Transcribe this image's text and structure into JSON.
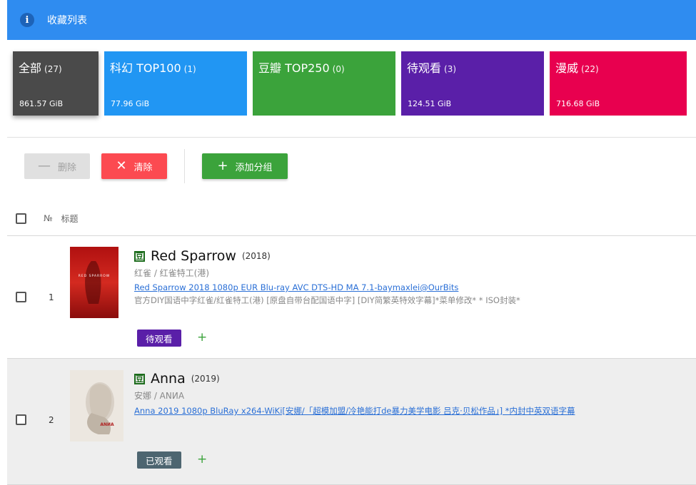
{
  "header": {
    "icon": "info-icon",
    "icon_glyph": "i",
    "title": "收藏列表"
  },
  "groups": [
    {
      "name": "全部",
      "count": "(27)",
      "size": "861.57 GiB",
      "color": "#4a4a4a",
      "active": true,
      "width": 120
    },
    {
      "name": "科幻 TOP100",
      "count": "(1)",
      "size": "77.96 GiB",
      "color": "#2196f3",
      "active": false,
      "width": 200
    },
    {
      "name": "豆瓣 TOP250",
      "count": "(0)",
      "size": "",
      "color": "#3ba33b",
      "active": false,
      "width": 200
    },
    {
      "name": "待观看",
      "count": "(3)",
      "size": "124.51 GiB",
      "color": "#5a1fa8",
      "active": false,
      "width": 200
    },
    {
      "name": "漫威",
      "count": "(22)",
      "size": "716.68 GiB",
      "color": "#e8004f",
      "active": false,
      "width": 200
    }
  ],
  "toolbar": {
    "delete_label": "删除",
    "delete_icon": "—",
    "clear_label": "清除",
    "clear_icon": "✕",
    "add_label": "添加分组",
    "add_icon": "+"
  },
  "table": {
    "col_no": "№",
    "col_title": "标题"
  },
  "rows": [
    {
      "no": "1",
      "title": "Red Sparrow",
      "year": "(2018)",
      "alt": "红雀 / 红雀特工(港)",
      "torrent": "Red Sparrow 2018 1080p EUR Blu-ray AVC DTS-HD MA 7.1-baymaxlei@OurBits",
      "subtitle": "官方DIY国语中字红雀/红雀特工(港) [原盘自带台配国语中字] [DIY简繁英特效字幕]*菜单修改* * ISO封装*",
      "tag": "待观看",
      "tag_color": "#5a1fa8",
      "poster_text": "RED SPARROW",
      "db_glyph": "豆"
    },
    {
      "no": "2",
      "title": "Anna",
      "year": "(2019)",
      "alt": "安娜 / ANИA",
      "torrent": "Anna 2019 1080p BluRay x264-WiKi[安娜/「超模加盟/冷艳能打de暴力美学电影 吕克·贝松作品」] *内封中英双语字幕",
      "subtitle": "",
      "tag": "已观看",
      "tag_color": "#4d6570",
      "poster_text": "ANИA",
      "db_glyph": "豆"
    }
  ],
  "add_tag_glyph": "+"
}
